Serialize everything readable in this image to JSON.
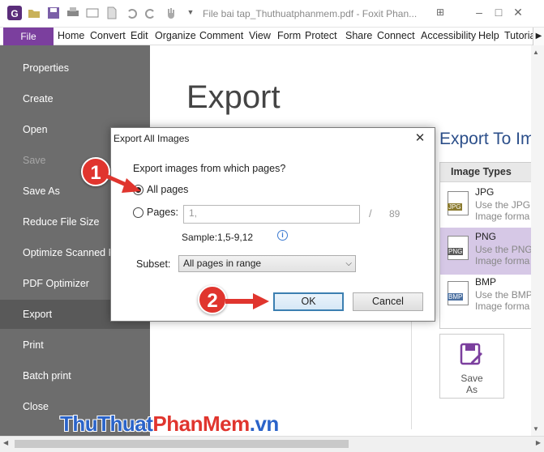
{
  "app": {
    "title": "File bai tap_Thuthuatphanmem.pdf - Foxit Phan..."
  },
  "menu": {
    "file_tab": "File",
    "items": [
      "Home",
      "Convert",
      "Edit",
      "Organize",
      "Comment",
      "View",
      "Form",
      "Protect",
      "Share",
      "Connect",
      "Accessibility",
      "Help",
      "Tutoria"
    ]
  },
  "sidebar": {
    "items": [
      {
        "label": "Properties",
        "state": "normal"
      },
      {
        "label": "Create",
        "state": "normal"
      },
      {
        "label": "Open",
        "state": "normal"
      },
      {
        "label": "Save",
        "state": "disabled"
      },
      {
        "label": "Save As",
        "state": "normal"
      },
      {
        "label": "Reduce File Size",
        "state": "normal"
      },
      {
        "label": "Optimize Scanned P",
        "state": "normal"
      },
      {
        "label": "PDF Optimizer",
        "state": "normal"
      },
      {
        "label": "Export",
        "state": "selected"
      },
      {
        "label": "Print",
        "state": "normal"
      },
      {
        "label": "Batch print",
        "state": "normal"
      },
      {
        "label": "Close",
        "state": "normal"
      }
    ]
  },
  "main": {
    "heading": "Export",
    "export_to": "Export To Im",
    "image_types_header": "Image Types",
    "types": [
      {
        "name": "JPG",
        "icon_label": "JPG",
        "desc1": "Use the JPG",
        "desc2": "Image forma",
        "selected": false,
        "icon_color": "#8a7a2e"
      },
      {
        "name": "PNG",
        "icon_label": "PNG",
        "desc1": "Use the PNG",
        "desc2": "Image forma",
        "selected": true,
        "icon_color": "#5a5a5a"
      },
      {
        "name": "BMP",
        "icon_label": "BMP",
        "desc1": "Use the BMP",
        "desc2": "Image forma",
        "selected": false,
        "icon_color": "#4a6fa0"
      }
    ],
    "save_as": {
      "line1": "Save",
      "line2": "As"
    }
  },
  "dialog": {
    "title": "Export All Images",
    "question": "Export images from which pages?",
    "all_pages_label": "All pages",
    "pages_label": "Pages:",
    "pages_value": "1,",
    "slash": "/",
    "total_pages": "89",
    "sample": "Sample:1,5-9,12",
    "info_icon": "i",
    "subset_label": "Subset:",
    "subset_value": "All pages in range",
    "ok_label": "OK",
    "cancel_label": "Cancel",
    "selected_option": "all"
  },
  "annotations": {
    "step1": "1",
    "step2": "2",
    "accent": "#e0352e"
  },
  "watermark": {
    "part1": "Thu",
    "part2": "Thuat",
    "part3": "PhanMem",
    "part4": ".vn"
  },
  "colors": {
    "file_tab": "#7b3f9e",
    "sidebar": "#6d6d6d",
    "heading_blue": "#2c4f8a"
  }
}
